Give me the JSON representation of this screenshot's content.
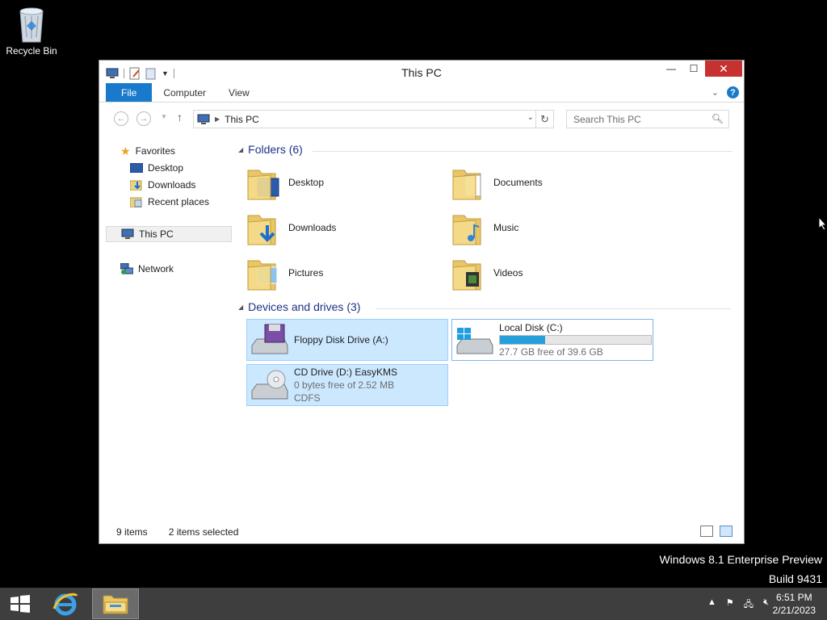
{
  "desktop": {
    "recycle_bin_label": "Recycle Bin"
  },
  "window": {
    "title": "This PC",
    "ribbon": {
      "tabs": [
        "File",
        "Computer",
        "View"
      ]
    },
    "address": {
      "location": "This PC"
    },
    "search": {
      "placeholder": "Search This PC"
    },
    "nav": {
      "favorites_label": "Favorites",
      "favorites": [
        "Desktop",
        "Downloads",
        "Recent places"
      ],
      "this_pc": "This PC",
      "network": "Network"
    },
    "folders_header": "Folders (6)",
    "folders": [
      "Desktop",
      "Documents",
      "Downloads",
      "Music",
      "Pictures",
      "Videos"
    ],
    "devices_header": "Devices and drives (3)",
    "drives": {
      "floppy": {
        "name": "Floppy Disk Drive (A:)"
      },
      "local": {
        "name": "Local Disk (C:)",
        "free": "27.7 GB free of 39.6 GB",
        "used_fraction": 0.3
      },
      "cd": {
        "name": "CD Drive (D:) EasyKMS",
        "free": "0 bytes free of 2.52 MB",
        "fs": "CDFS"
      }
    },
    "status": {
      "items": "9 items",
      "selected": "2 items selected"
    }
  },
  "watermark": {
    "line1": "Windows 8.1 Enterprise Preview",
    "line2": "Build 9431"
  },
  "taskbar": {
    "time": "6:51 PM",
    "date": "2/21/2023"
  },
  "colors": {
    "accent": "#1979ca",
    "close": "#c7312f",
    "selection": "#cce8ff",
    "progress": "#26a0da",
    "taskbar": "#3e3e3e"
  }
}
